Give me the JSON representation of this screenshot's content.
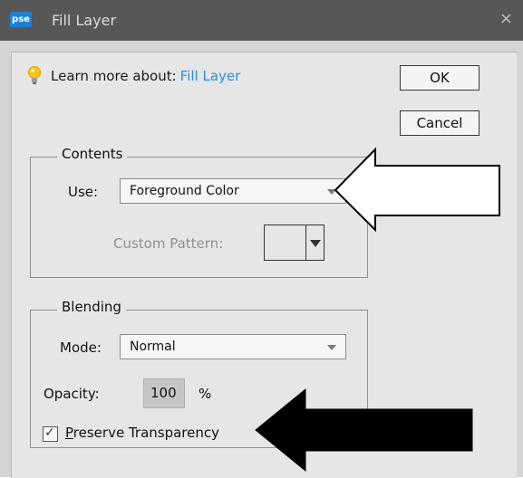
{
  "titlebar": {
    "app_badge": "pse",
    "title": "Fill Layer",
    "close_glyph": "×"
  },
  "learn": {
    "prefix": "Learn more about:",
    "link": "Fill Layer",
    "icon": "lightbulb-icon"
  },
  "buttons": {
    "ok": "OK",
    "cancel": "Cancel"
  },
  "contents": {
    "legend": "Contents",
    "use_label": "Use:",
    "use_value": "Foreground Color",
    "custom_pattern_label": "Custom Pattern:"
  },
  "blending": {
    "legend": "Blending",
    "mode_label": "Mode:",
    "mode_value": "Normal",
    "opacity_label": "Opacity:",
    "opacity_value": "100",
    "opacity_unit": "%",
    "preserve_prefix": "P",
    "preserve_rest": "reserve Transparency",
    "preserve_checked": true
  },
  "colors": {
    "link": "#2f8ee0",
    "titlebar": "#575757",
    "dialog_bg": "#e6e6e6"
  }
}
